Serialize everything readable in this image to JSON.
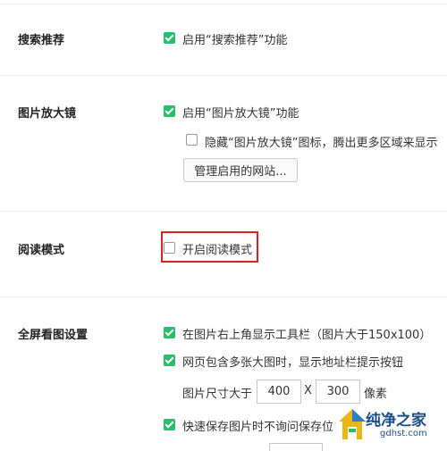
{
  "sections": {
    "search": {
      "title": "搜索推荐",
      "options": [
        "启用“搜索推荐”功能"
      ]
    },
    "magnifier": {
      "title": "图片放大镜",
      "options": [
        "启用“图片放大镜”功能",
        "隐藏“图片放大镜”图标，腾出更多区域来显示"
      ],
      "button": "管理启用的网站..."
    },
    "reader": {
      "title": "阅读模式",
      "options": [
        "开启阅读模式"
      ]
    },
    "fullscreen": {
      "title": "全屏看图设置",
      "options": [
        "在图片右上角显示工具栏（图片大于150x100）",
        "网页包含多张大图时，显示地址栏提示按钮",
        "快速保存图片时不询问保存位"
      ],
      "size_label": "图片尺寸大于",
      "width": "400",
      "times": "X",
      "height": "300",
      "unit": "像素"
    }
  },
  "watermark": {
    "title": "纯净之家",
    "url": "gdhst.com"
  },
  "colors": {
    "check": "#2bbd6b",
    "highlight": "#e02020"
  }
}
